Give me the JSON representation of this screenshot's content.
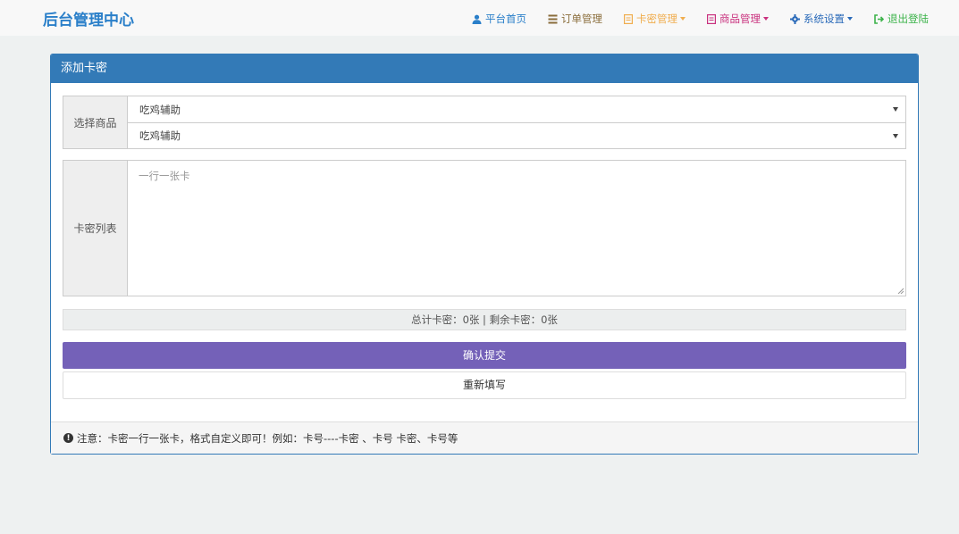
{
  "brand": "后台管理中心",
  "nav": {
    "home": {
      "label": "平台首页",
      "color": "#2a7fc9"
    },
    "orders": {
      "label": "订单管理",
      "color": "#8a6d3b"
    },
    "cards": {
      "label": "卡密管理",
      "color": "#f0ad4e"
    },
    "goods": {
      "label": "商品管理",
      "color": "#c9317e"
    },
    "settings": {
      "label": "系统设置",
      "color": "#2a6ab9"
    },
    "logout": {
      "label": "退出登陆",
      "color": "#3cb34a"
    }
  },
  "panel": {
    "title": "添加卡密",
    "select_label": "选择商品",
    "select_primary": "吃鸡辅助",
    "select_secondary": "吃鸡辅助",
    "list_label": "卡密列表",
    "list_placeholder": "一行一张卡",
    "stats": "总计卡密：0张 | 剩余卡密：0张",
    "submit": "确认提交",
    "reset": "重新填写",
    "note": "注意：卡密一行一张卡，格式自定义即可！例如：卡号----卡密 、卡号 卡密、卡号等"
  },
  "colors": {
    "primary": "#337ab7",
    "submit": "#7461b8"
  }
}
